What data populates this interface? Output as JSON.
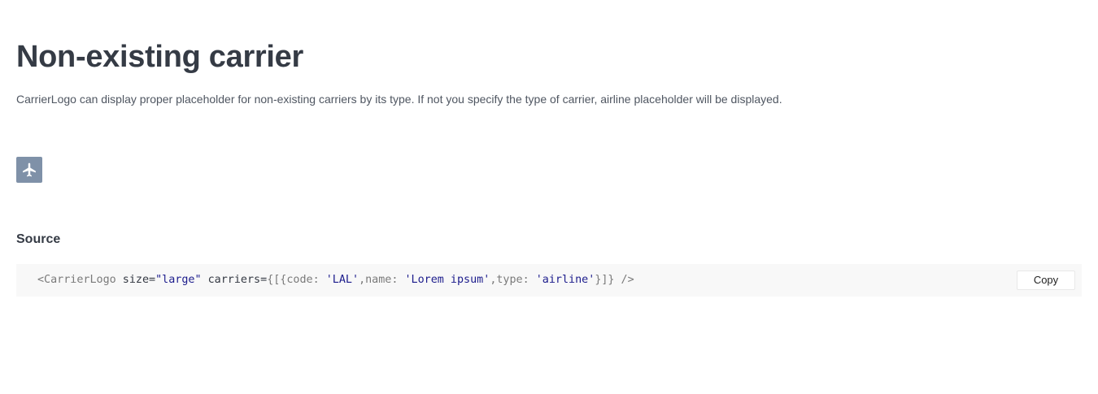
{
  "header": {
    "title": "Non-existing carrier",
    "description": "CarrierLogo can display proper placeholder for non-existing carriers by its type. If not you specify the type of carrier, airline placeholder will be displayed."
  },
  "preview": {
    "icon": "airplane-icon",
    "background_color": "#7f91a8"
  },
  "source": {
    "heading": "Source",
    "code": {
      "open_tag": "<CarrierLogo",
      "attr_size": " size=",
      "size_value": "\"large\"",
      "attr_carriers": " carriers=",
      "open_braces": "{[{",
      "key_code": "code: ",
      "code_value": "'LAL'",
      "key_name": ",name: ",
      "name_value": "'Lorem ipsum'",
      "key_type": ",type: ",
      "type_value": "'airline'",
      "close_braces": "}]}",
      "close_tag": " />"
    },
    "copy_label": "Copy"
  }
}
